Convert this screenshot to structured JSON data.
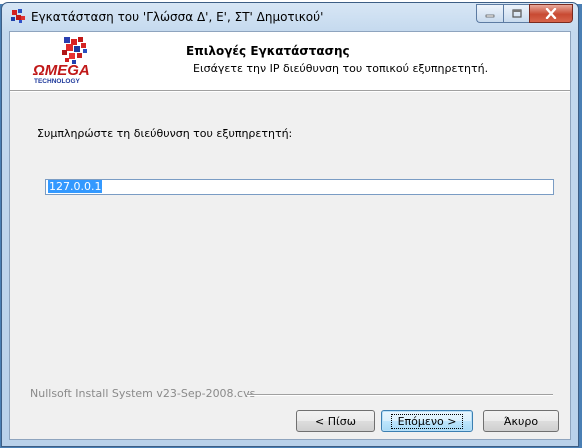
{
  "window": {
    "title": "Εγκατάσταση του 'Γλώσσα Δ', Ε', ΣΤ' Δημοτικού'"
  },
  "header": {
    "title": "Επιλογές Εγκατάστασης",
    "subtitle": "Εισάγετε την IP διεύθυνση του τοπικού εξυπηρετητή.",
    "logo_text": "ΩMEGA",
    "logo_subtext": "TECHNOLOGY"
  },
  "form": {
    "prompt": "Συμπληρώστε τη διεύθυνση του εξυπηρετητή:",
    "ip_value": "127.0.0.1"
  },
  "footer": {
    "branding": "Nullsoft Install System v23-Sep-2008.cvs",
    "back_label": "< Πίσω",
    "next_label": "Επόμενο >",
    "cancel_label": "Άκυρο"
  },
  "colors": {
    "desktop": "#4a7fb4",
    "selection": "#3399ff",
    "close_button": "#c84a32"
  },
  "icons": [
    "app-icon",
    "minimize-icon",
    "maximize-icon",
    "close-icon"
  ]
}
